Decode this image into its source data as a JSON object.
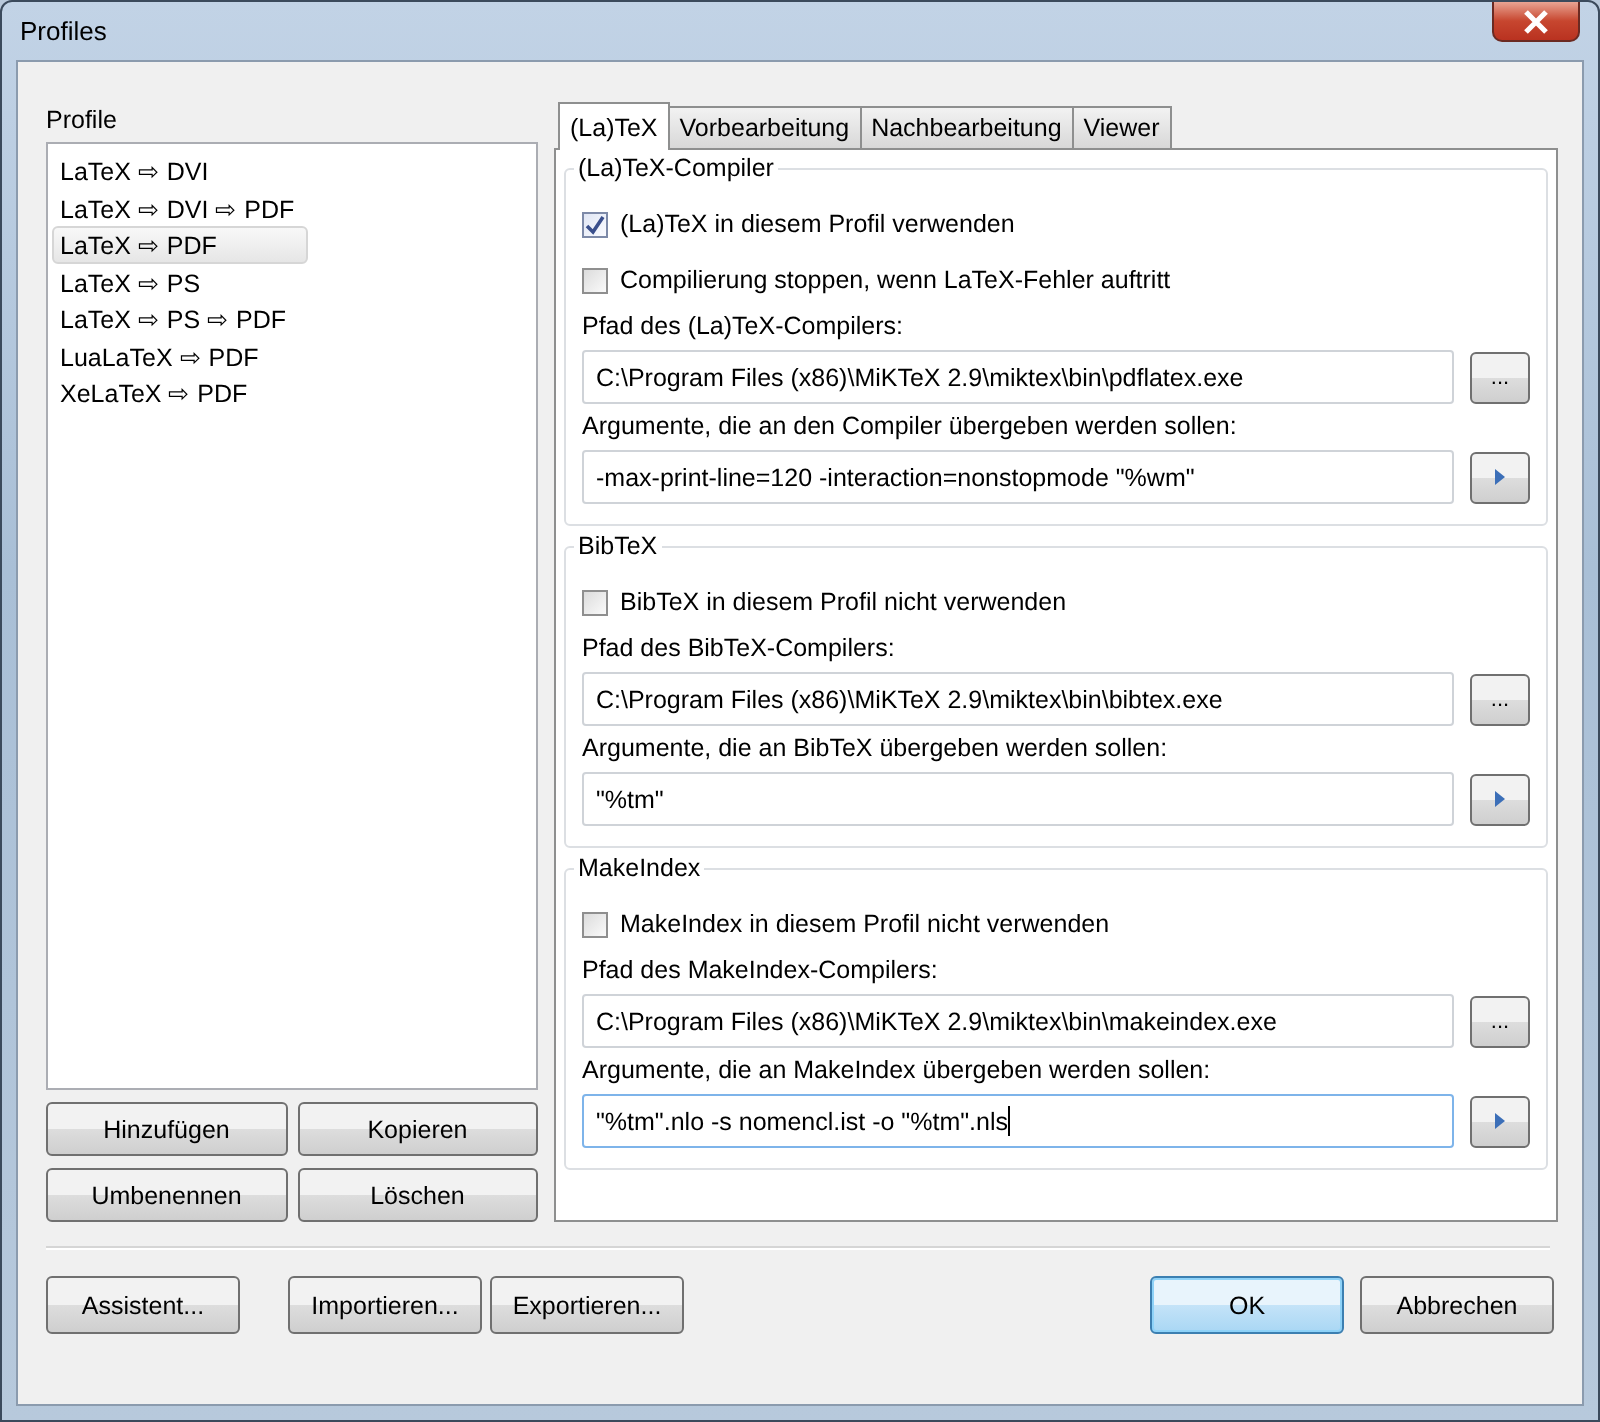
{
  "window": {
    "title": "Profiles"
  },
  "profile_list": {
    "label": "Profile",
    "items": [
      {
        "label": "LaTeX ⇨ DVI",
        "selected": false
      },
      {
        "label": "LaTeX ⇨ DVI ⇨ PDF",
        "selected": false
      },
      {
        "label": "LaTeX ⇨ PDF",
        "selected": true
      },
      {
        "label": "LaTeX ⇨ PS",
        "selected": false
      },
      {
        "label": "LaTeX ⇨ PS ⇨ PDF",
        "selected": false
      },
      {
        "label": "LuaLaTeX ⇨ PDF",
        "selected": false
      },
      {
        "label": "XeLaTeX ⇨ PDF",
        "selected": false
      }
    ]
  },
  "list_buttons": [
    "Hinzufügen",
    "Kopieren",
    "Umbenennen",
    "Löschen"
  ],
  "tabs": [
    {
      "label": "(La)TeX",
      "selected": true
    },
    {
      "label": "Vorbearbeitung",
      "selected": false
    },
    {
      "label": "Nachbearbeitung",
      "selected": false
    },
    {
      "label": "Viewer",
      "selected": false
    }
  ],
  "groups": [
    {
      "title": "(La)TeX-Compiler",
      "rows": [
        {
          "kind": "checkbox",
          "label": "(La)TeX in diesem Profil verwenden",
          "checked": true
        },
        {
          "kind": "checkbox",
          "label": "Compilierung stoppen, wenn LaTeX-Fehler auftritt",
          "checked": false
        },
        {
          "kind": "field",
          "label": "Pfad des (La)TeX-Compilers:",
          "value": "C:\\Program Files (x86)\\MiKTeX 2.9\\miktex\\bin\\pdflatex.exe",
          "button": {
            "kind": "browse",
            "label": "..."
          },
          "focused": false
        },
        {
          "kind": "field",
          "label": "Argumente, die an den Compiler übergeben werden sollen:",
          "value": "-max-print-line=120 -interaction=nonstopmode \"%wm\"",
          "button": {
            "kind": "menu"
          },
          "focused": false
        }
      ]
    },
    {
      "title": "BibTeX",
      "rows": [
        {
          "kind": "checkbox",
          "label": "BibTeX in diesem Profil nicht verwenden",
          "checked": false
        },
        {
          "kind": "field",
          "label": "Pfad des BibTeX-Compilers:",
          "value": "C:\\Program Files (x86)\\MiKTeX 2.9\\miktex\\bin\\bibtex.exe",
          "button": {
            "kind": "browse",
            "label": "..."
          },
          "focused": false
        },
        {
          "kind": "field",
          "label": "Argumente, die an BibTeX übergeben werden sollen:",
          "value": "\"%tm\"",
          "button": {
            "kind": "menu"
          },
          "focused": false
        }
      ]
    },
    {
      "title": "MakeIndex",
      "rows": [
        {
          "kind": "checkbox",
          "label": "MakeIndex in diesem Profil nicht verwenden",
          "checked": false
        },
        {
          "kind": "field",
          "label": "Pfad des MakeIndex-Compilers:",
          "value": "C:\\Program Files (x86)\\MiKTeX 2.9\\miktex\\bin\\makeindex.exe",
          "button": {
            "kind": "browse",
            "label": "..."
          },
          "focused": false
        },
        {
          "kind": "field",
          "label": "Argumente, die an MakeIndex übergeben werden sollen:",
          "value": "\"%tm\".nlo -s nomencl.ist -o \"%tm\".nls",
          "button": {
            "kind": "menu"
          },
          "focused": true
        }
      ]
    }
  ],
  "footer_left": [
    [
      "Assistent..."
    ],
    [
      "Importieren...",
      "Exportieren..."
    ]
  ],
  "footer_right": [
    {
      "label": "OK",
      "default": true
    },
    {
      "label": "Abbrechen",
      "default": false
    }
  ]
}
